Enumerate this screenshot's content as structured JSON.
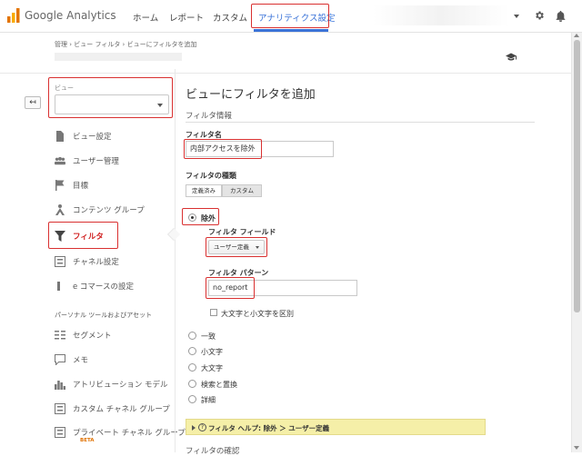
{
  "header": {
    "logo_text": "Google Analytics",
    "nav": [
      "ホーム",
      "レポート",
      "カスタム",
      "アナリティクス設定"
    ],
    "active_nav": "アナリティクス設定",
    "accent_color": "#3a73d8"
  },
  "breadcrumb": "管理 › ビュー フィルタ › ビューにフィルタを追加",
  "sidebar": {
    "view_label": "ビュー",
    "items": [
      {
        "label": "ビュー設定",
        "icon": "document-icon"
      },
      {
        "label": "ユーザー管理",
        "icon": "users-icon"
      },
      {
        "label": "目標",
        "icon": "flag-icon"
      },
      {
        "label": "コンテンツ グループ",
        "icon": "person-group-icon"
      },
      {
        "label": "フィルタ",
        "icon": "funnel-icon",
        "active": true
      },
      {
        "label": "チャネル設定",
        "icon": "channel-icon"
      },
      {
        "label": "e コマースの設定",
        "icon": "cart-icon"
      }
    ],
    "section_title": "パーソナル ツールおよびアセット",
    "tools": [
      {
        "label": "セグメント",
        "icon": "segment-icon"
      },
      {
        "label": "メモ",
        "icon": "note-icon"
      },
      {
        "label": "アトリビューション モデル",
        "icon": "bar-chart-icon"
      },
      {
        "label": "カスタム チャネル グループ",
        "icon": "channel-group-icon"
      },
      {
        "label": "プライベート チャネル グループ",
        "icon": "private-channel-icon"
      }
    ],
    "beta": "BETA"
  },
  "main": {
    "title": "ビューにフィルタを追加",
    "section_title": "フィルタ情報",
    "filter_name_label": "フィルタ名",
    "filter_name_value": "内部アクセスを除外",
    "filter_type_label": "フィルタの種類",
    "type_buttons": [
      "定義済み",
      "カスタム"
    ],
    "exclude_label": "除外",
    "filter_field_label": "フィルタ フィールド",
    "filter_field_value": "ユーザー定義",
    "filter_pattern_label": "フィルタ パターン",
    "filter_pattern_value": "no_report",
    "case_label": "大文字と小文字を区別",
    "other_options": [
      "一致",
      "小文字",
      "大文字",
      "検索と置換",
      "詳細"
    ],
    "help_text": "フィルタ ヘルプ: 除外 ＞ ユーザー定義",
    "help_q": "?",
    "bottom_title": "フィルタの確認"
  },
  "highlight_color": "#d93030"
}
